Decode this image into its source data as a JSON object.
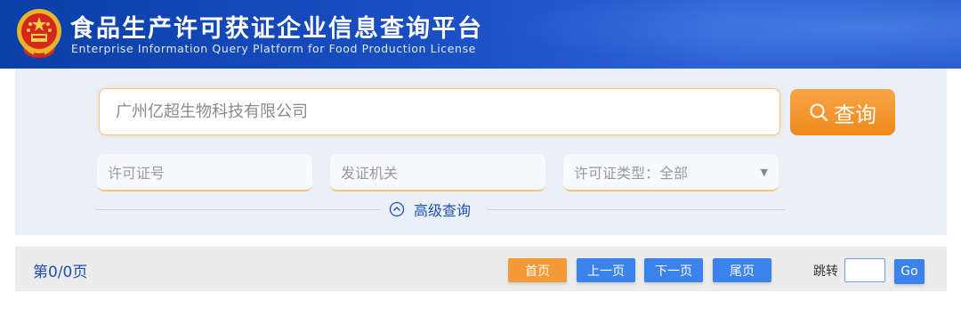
{
  "header": {
    "title_cn": "食品生产许可获证企业信息查询平台",
    "title_en": "Enterprise Information Query Platform for Food Production License"
  },
  "search": {
    "main_placeholder": "广州亿超生物科技有限公司",
    "query_button": "查询",
    "license_no_placeholder": "许可证号",
    "issuing_authority_placeholder": "发证机关",
    "license_type_label": "许可证类型：全部",
    "advanced_query": "高级查询"
  },
  "pager": {
    "page_info": "第0/0页",
    "first": "首页",
    "prev": "上一页",
    "next": "下一页",
    "last": "尾页",
    "jump_label": "跳转",
    "go": "Go"
  },
  "colors": {
    "header_blue": "#1a4fc4",
    "accent_orange": "#ef8a1c",
    "button_blue": "#3b82ec",
    "link_blue": "#1f4fb3"
  }
}
